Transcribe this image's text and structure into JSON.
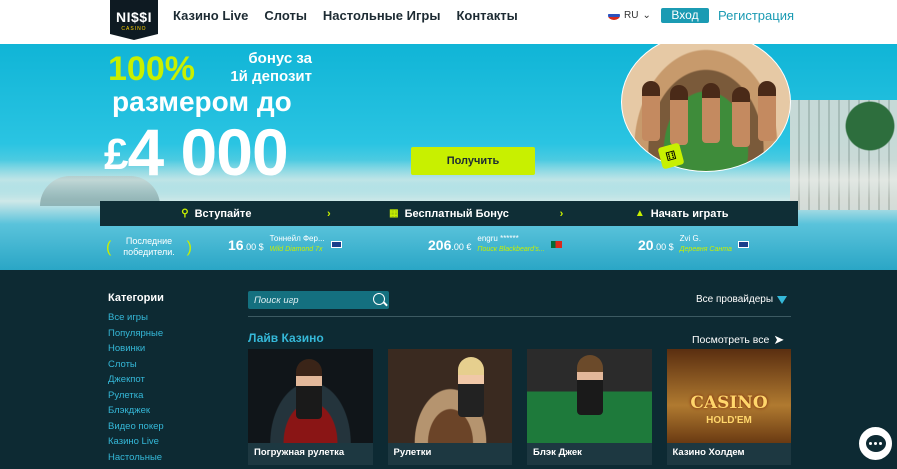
{
  "brand": {
    "logo_text": "NI$$I",
    "logo_sub": "CASINO"
  },
  "nav": {
    "items": [
      "Казино Live",
      "Слоты",
      "Настольные Игры",
      "Контакты"
    ]
  },
  "header": {
    "lang": "RU",
    "login": "Вход",
    "register": "Регистрация"
  },
  "hero": {
    "percent": "100%",
    "bonus_line1": "бонус за",
    "bonus_line2": "1й депозит",
    "size_text": "размером до",
    "currency": "£",
    "amount": "4 000",
    "cta": "Получить"
  },
  "steps": [
    {
      "label": "Вступайте",
      "icon": "search-icon"
    },
    {
      "label": "Бесплатный Бонус",
      "icon": "gift-icon"
    },
    {
      "label": "Начать играть",
      "icon": "chip-icon"
    }
  ],
  "winners": {
    "label": "Последние победители.",
    "items": [
      {
        "amount": "16",
        "fraction": ".00 $",
        "name": "Тоннейл Фер...",
        "game": "Wild Diamond 7x",
        "flag": "au"
      },
      {
        "amount": "206",
        "fraction": ".00 €",
        "name": "engru ******",
        "game": "Поиск Blackbeard's...",
        "flag": "pt"
      },
      {
        "amount": "20",
        "fraction": ".00 $",
        "name": "Zvi G.",
        "game": "Деревня Санта",
        "flag": "au"
      }
    ]
  },
  "sidebar": {
    "title": "Категории",
    "items": [
      "Все игры",
      "Популярные",
      "Новинки",
      "Слоты",
      "Джекпот",
      "Рулетка",
      "Блэкджек",
      "Видео покер",
      "Казино Live",
      "Настольные"
    ]
  },
  "search": {
    "placeholder": "Поиск игр"
  },
  "providers": {
    "label": "Все провайдеры"
  },
  "live": {
    "title": "Лайв Казино",
    "see_all": "Посмотреть все",
    "games": [
      "Погружная рулетка",
      "Рулетки",
      "Блэк Джек",
      "Казино Холдем"
    ],
    "casino_holdem_art_line1": "CASINO",
    "casino_holdem_art_line2": "HOLD'EM"
  },
  "colors": {
    "accent": "#c8f000",
    "brand": "#1b9bb3",
    "dark": "#0d2a33",
    "link": "#35b8d8"
  }
}
